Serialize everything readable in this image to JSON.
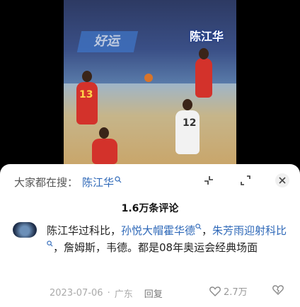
{
  "video": {
    "overlay_name": "陈江华",
    "banner_text": "好运",
    "jersey_numbers": [
      "13",
      "12"
    ]
  },
  "search": {
    "prefix": "大家都在搜：",
    "term": "陈江华"
  },
  "comments_header": {
    "count_label": "1.6万条评论"
  },
  "comment": {
    "part1": "陈江华过科比，",
    "link1": "孙悦大帽霍华德",
    "part2": "，",
    "link2": "朱芳雨迎射科比",
    "part3": "，詹姆斯，韦德。都是08年奥运会经典场面",
    "date": "2023-07-06",
    "separator": "·",
    "location": "广东",
    "reply_label": "回复",
    "like_count": "2.7万"
  },
  "icons": {
    "top": [
      "collapse-icon",
      "fullscreen-icon",
      "close-icon"
    ],
    "like": "heart-icon",
    "dislike": "broken-heart-icon",
    "search_mini": "search-icon"
  },
  "colors": {
    "link": "#2e68b8",
    "sheet_bg": "#ffffff",
    "page_bg": "#000000"
  }
}
